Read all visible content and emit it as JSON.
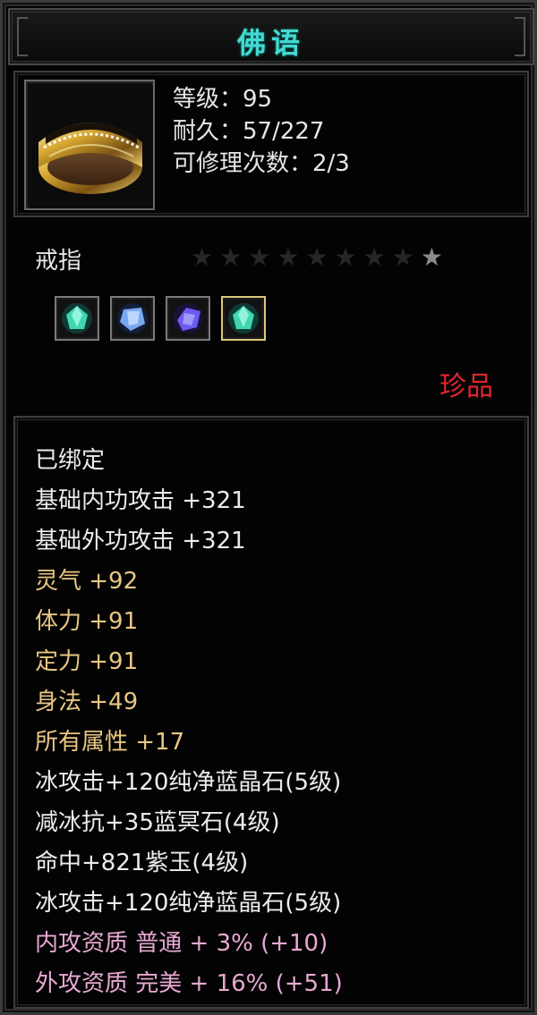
{
  "window": {
    "title": "佛语"
  },
  "item": {
    "stats": [
      "等级：95",
      "耐久：57/227",
      "可修理次数：2/3"
    ],
    "type": "戒指",
    "stars_total": 9,
    "stars_lit": 1,
    "gems": [
      {
        "icon": "green-crystal-gem-icon",
        "color": "#3fd6b0"
      },
      {
        "icon": "blue-crystal-gem-icon",
        "color": "#7aa8f0"
      },
      {
        "icon": "purple-crystal-gem-icon",
        "color": "#7a6cf0"
      },
      {
        "icon": "green-crystal-gem-icon",
        "color": "#3fd6b0"
      }
    ],
    "rarity": "珍品",
    "rarity_color": "#e2262e"
  },
  "attributes": [
    "已绑定",
    "基础内功攻击 +321",
    "基础外功攻击 +321",
    "灵气 +92",
    "体力 +91",
    "定力 +91",
    "身法 +49",
    "所有属性 +17",
    "冰攻击+120纯净蓝晶石(5级)",
    "减冰抗+35蓝冥石(4级)",
    "命中+821紫玉(4级)",
    "冰攻击+120纯净蓝晶石(5级)",
    "内攻资质 普通 + 3% (+10)",
    "外攻资质 完美 + 16% (+51)"
  ],
  "colors": {
    "title": "#45d8d0",
    "white": "#ececec",
    "gold": "#e8c783",
    "pink": "#e8a9d2"
  }
}
